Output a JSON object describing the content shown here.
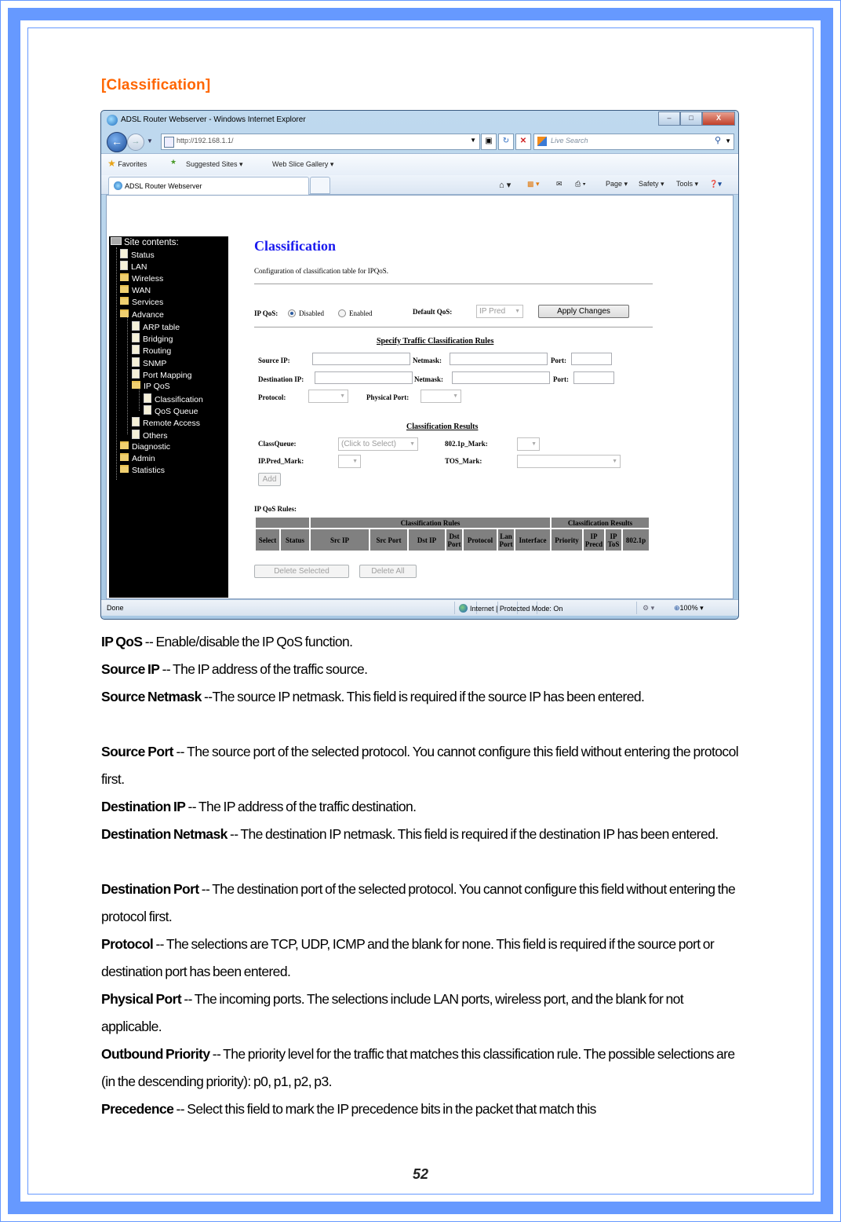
{
  "document": {
    "section_title": "[Classification]",
    "page_number": "52",
    "border_color": "#6699ff",
    "title_color": "#ff6600"
  },
  "browser": {
    "window_title": "ADSL Router Webserver - Windows Internet Explorer",
    "window_buttons": {
      "minimize": "–",
      "maximize": "□",
      "close": "X"
    },
    "address": "http://192.168.1.1/",
    "search_placeholder": "Live Search",
    "favorites_label": "Favorites",
    "favorites": [
      "Suggested Sites ▾",
      "Web Slice Gallery ▾"
    ],
    "tab_label": "ADSL Router Webserver",
    "commands": [
      "Page ▾",
      "Safety ▾",
      "Tools ▾"
    ],
    "status_text": "Done",
    "zone_text": "Internet | Protected Mode: On",
    "zoom_level": "100%"
  },
  "sidebar": {
    "root": "Site contents:",
    "items": [
      {
        "label": "Status",
        "level": 1,
        "icon": "doc"
      },
      {
        "label": "LAN",
        "level": 1,
        "icon": "doc"
      },
      {
        "label": "Wireless",
        "level": 1,
        "icon": "folder"
      },
      {
        "label": "WAN",
        "level": 1,
        "icon": "folder"
      },
      {
        "label": "Services",
        "level": 1,
        "icon": "folder"
      },
      {
        "label": "Advance",
        "level": 1,
        "icon": "folder-open"
      },
      {
        "label": "ARP table",
        "level": 2,
        "icon": "doc"
      },
      {
        "label": "Bridging",
        "level": 2,
        "icon": "doc"
      },
      {
        "label": "Routing",
        "level": 2,
        "icon": "doc"
      },
      {
        "label": "SNMP",
        "level": 2,
        "icon": "doc"
      },
      {
        "label": "Port Mapping",
        "level": 2,
        "icon": "doc"
      },
      {
        "label": "IP QoS",
        "level": 2,
        "icon": "folder-open"
      },
      {
        "label": "Classification",
        "level": 3,
        "icon": "doc"
      },
      {
        "label": "QoS Queue",
        "level": 3,
        "icon": "doc"
      },
      {
        "label": "Remote Access",
        "level": 2,
        "icon": "doc"
      },
      {
        "label": "Others",
        "level": 2,
        "icon": "doc"
      },
      {
        "label": "Diagnostic",
        "level": 1,
        "icon": "folder"
      },
      {
        "label": "Admin",
        "level": 1,
        "icon": "folder"
      },
      {
        "label": "Statistics",
        "level": 1,
        "icon": "folder"
      }
    ]
  },
  "page": {
    "heading": "Classification",
    "description": "Configuration of classification table for IPQoS.",
    "ipqos": {
      "label": "IP QoS:",
      "options": [
        "Disabled",
        "Enabled"
      ],
      "selected": "Disabled",
      "default_qos_label": "Default QoS:",
      "default_qos_value": "IP Pred",
      "apply_button": "Apply Changes"
    },
    "rules": {
      "heading": "Specify Traffic Classification Rules",
      "source_ip_label": "Source IP:",
      "source_ip_value": "",
      "netmask_label": "Netmask:",
      "source_netmask_value": "",
      "port_label": "Port:",
      "source_port_value": "",
      "dest_ip_label": "Destination IP:",
      "dest_ip_value": "",
      "dest_netmask_value": "",
      "dest_port_value": "",
      "protocol_label": "Protocol:",
      "protocol_value": "",
      "physical_port_label": "Physical Port:",
      "physical_port_value": ""
    },
    "results": {
      "heading": "Classification Results",
      "classqueue_label": "ClassQueue:",
      "classqueue_value": "(Click to Select)",
      "mark_8021p_label": "802.1p_Mark:",
      "mark_8021p_value": "",
      "ippred_label": "IP.Pred_Mark:",
      "ippred_value": "",
      "tos_label": "TOS_Mark:",
      "tos_value": "",
      "add_button": "Add"
    },
    "table": {
      "title": "IP QoS Rules:",
      "group_headers": [
        "Classification Rules",
        "Classification Results"
      ],
      "columns": [
        "Select",
        "Status",
        "Src IP",
        "Src Port",
        "Dst IP",
        "Dst Port",
        "Protocol",
        "Lan Port",
        "Interface",
        "Priority",
        "IP Precd",
        "IP ToS",
        "802.1p"
      ],
      "rows": []
    },
    "delete_selected_button": "Delete Selected",
    "delete_all_button": "Delete All"
  },
  "descriptions": [
    {
      "term": "IP QoS",
      "text": " -- Enable/disable the IP QoS function."
    },
    {
      "term": "Source IP",
      "text": " -- The IP address of the traffic source."
    },
    {
      "term": "Source Netmask",
      "text": " --The source IP netmask. This field is required if the source IP has been entered."
    },
    {
      "term": "Source Port",
      "text": " -- The source port of the selected protocol. You cannot configure this field without entering the protocol first."
    },
    {
      "term": "Destination IP",
      "text": " -- The IP address of the traffic destination."
    },
    {
      "term": "Destination Netmask",
      "text": " -- The destination IP netmask. This field is required if the destination IP has been entered."
    },
    {
      "term": "Destination Port",
      "text": " -- The destination port of the selected protocol. You cannot configure this field without entering the protocol first."
    },
    {
      "term": "Protocol",
      "text": " -- The selections are TCP, UDP, ICMP and the blank for none. This field is required if the source port or destination port has been entered."
    },
    {
      "term": "Physical Port",
      "text": " -- The incoming ports. The selections include LAN ports, wireless port, and the blank for not applicable."
    },
    {
      "term": "Outbound Priority",
      "text": " -- The priority level for the traffic that matches this classification rule. The possible selections are (in the descending priority): p0, p1, p2, p3."
    },
    {
      "term": "Precedence",
      "text": " -- Select this field to mark the IP precedence bits in the packet that match this"
    }
  ]
}
